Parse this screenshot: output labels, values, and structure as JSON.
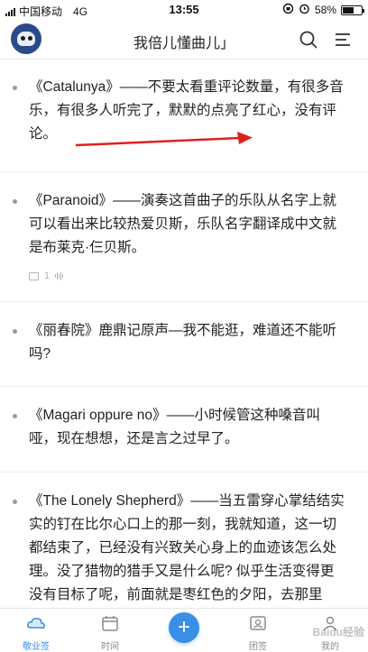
{
  "status_bar": {
    "carrier": "中国移动",
    "network": "4G",
    "time": "13:55",
    "battery": "58%",
    "battery_level": 0.58
  },
  "header": {
    "title": "我倍儿懂曲儿」"
  },
  "posts": [
    {
      "text": "《Catalunya》——不要太看重评论数量，有很多音乐，有很多人听完了，默默的点亮了红心，没有评论。"
    },
    {
      "text": "《Paranoid》——演奏这首曲子的乐队从名字上就可以看出来比较热爱贝斯，乐队名字翻译成中文就是布莱克·仨贝斯。",
      "meta_count": "1"
    },
    {
      "text": "《丽春院》鹿鼎记原声—我不能逛，难道还不能听吗?"
    },
    {
      "text": "《Magari oppure no》——小时候管这种嗓音叫哑，现在想想，还是言之过早了。"
    },
    {
      "text": "《The Lonely Shepherd》——当五雷穿心掌结结实实的钉在比尔心口上的那一刻，我就知道，这一切都结束了，已经没有兴致关心身上的血迹该怎么处理。没了猎物的猎手又是什么呢? 似乎生活变得更没有目标了呢，前面就是枣红色的夕阳，去那里吧，也许那里有答案，很多人说听到了孤独，其实我并不孤独，因为我的背后还有阳都当梦想"
    }
  ],
  "tabbar": {
    "tabs": [
      {
        "label": "敬业签"
      },
      {
        "label": "时间"
      },
      {
        "label": "+"
      },
      {
        "label": "团签"
      },
      {
        "label": "我的"
      }
    ],
    "watermark": "Baidu经验"
  },
  "colors": {
    "accent": "#3a8ee6",
    "arrow": "#e02020"
  }
}
